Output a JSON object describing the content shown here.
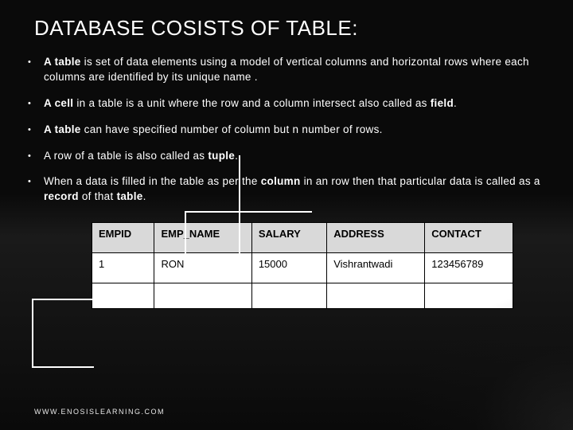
{
  "title": "DATABASE COSISTS OF TABLE:",
  "bullets": [
    {
      "pre": "A table",
      "rest": " is set of data elements using a model of vertical columns and horizontal rows where each columns are identified by its unique name ."
    },
    {
      "pre": "A cell",
      "rest": " in a table is a unit where the row and a column intersect also called as ",
      "post": "field",
      "tail": "."
    },
    {
      "pre": "A table",
      "rest": " can have specified number of column but n number of rows."
    },
    {
      "plain1": "A row of a table is also called as ",
      "bold1": "tuple",
      "tail": "."
    },
    {
      "plain1": "When a data is filled in the table as per the ",
      "bold1": "column",
      "plain2": " in an row then that particular data is called as a ",
      "bold2": "record",
      "plain3": " of that ",
      "bold3": "table",
      "tail": "."
    }
  ],
  "table": {
    "headers": [
      "EMPID",
      "EMP_NAME",
      "SALARY",
      "ADDRESS",
      "CONTACT"
    ],
    "row": [
      "1",
      "RON",
      "15000",
      "Vishrantwadi",
      "123456789"
    ]
  },
  "footer": "WWW.ENOSISLEARNING.COM"
}
